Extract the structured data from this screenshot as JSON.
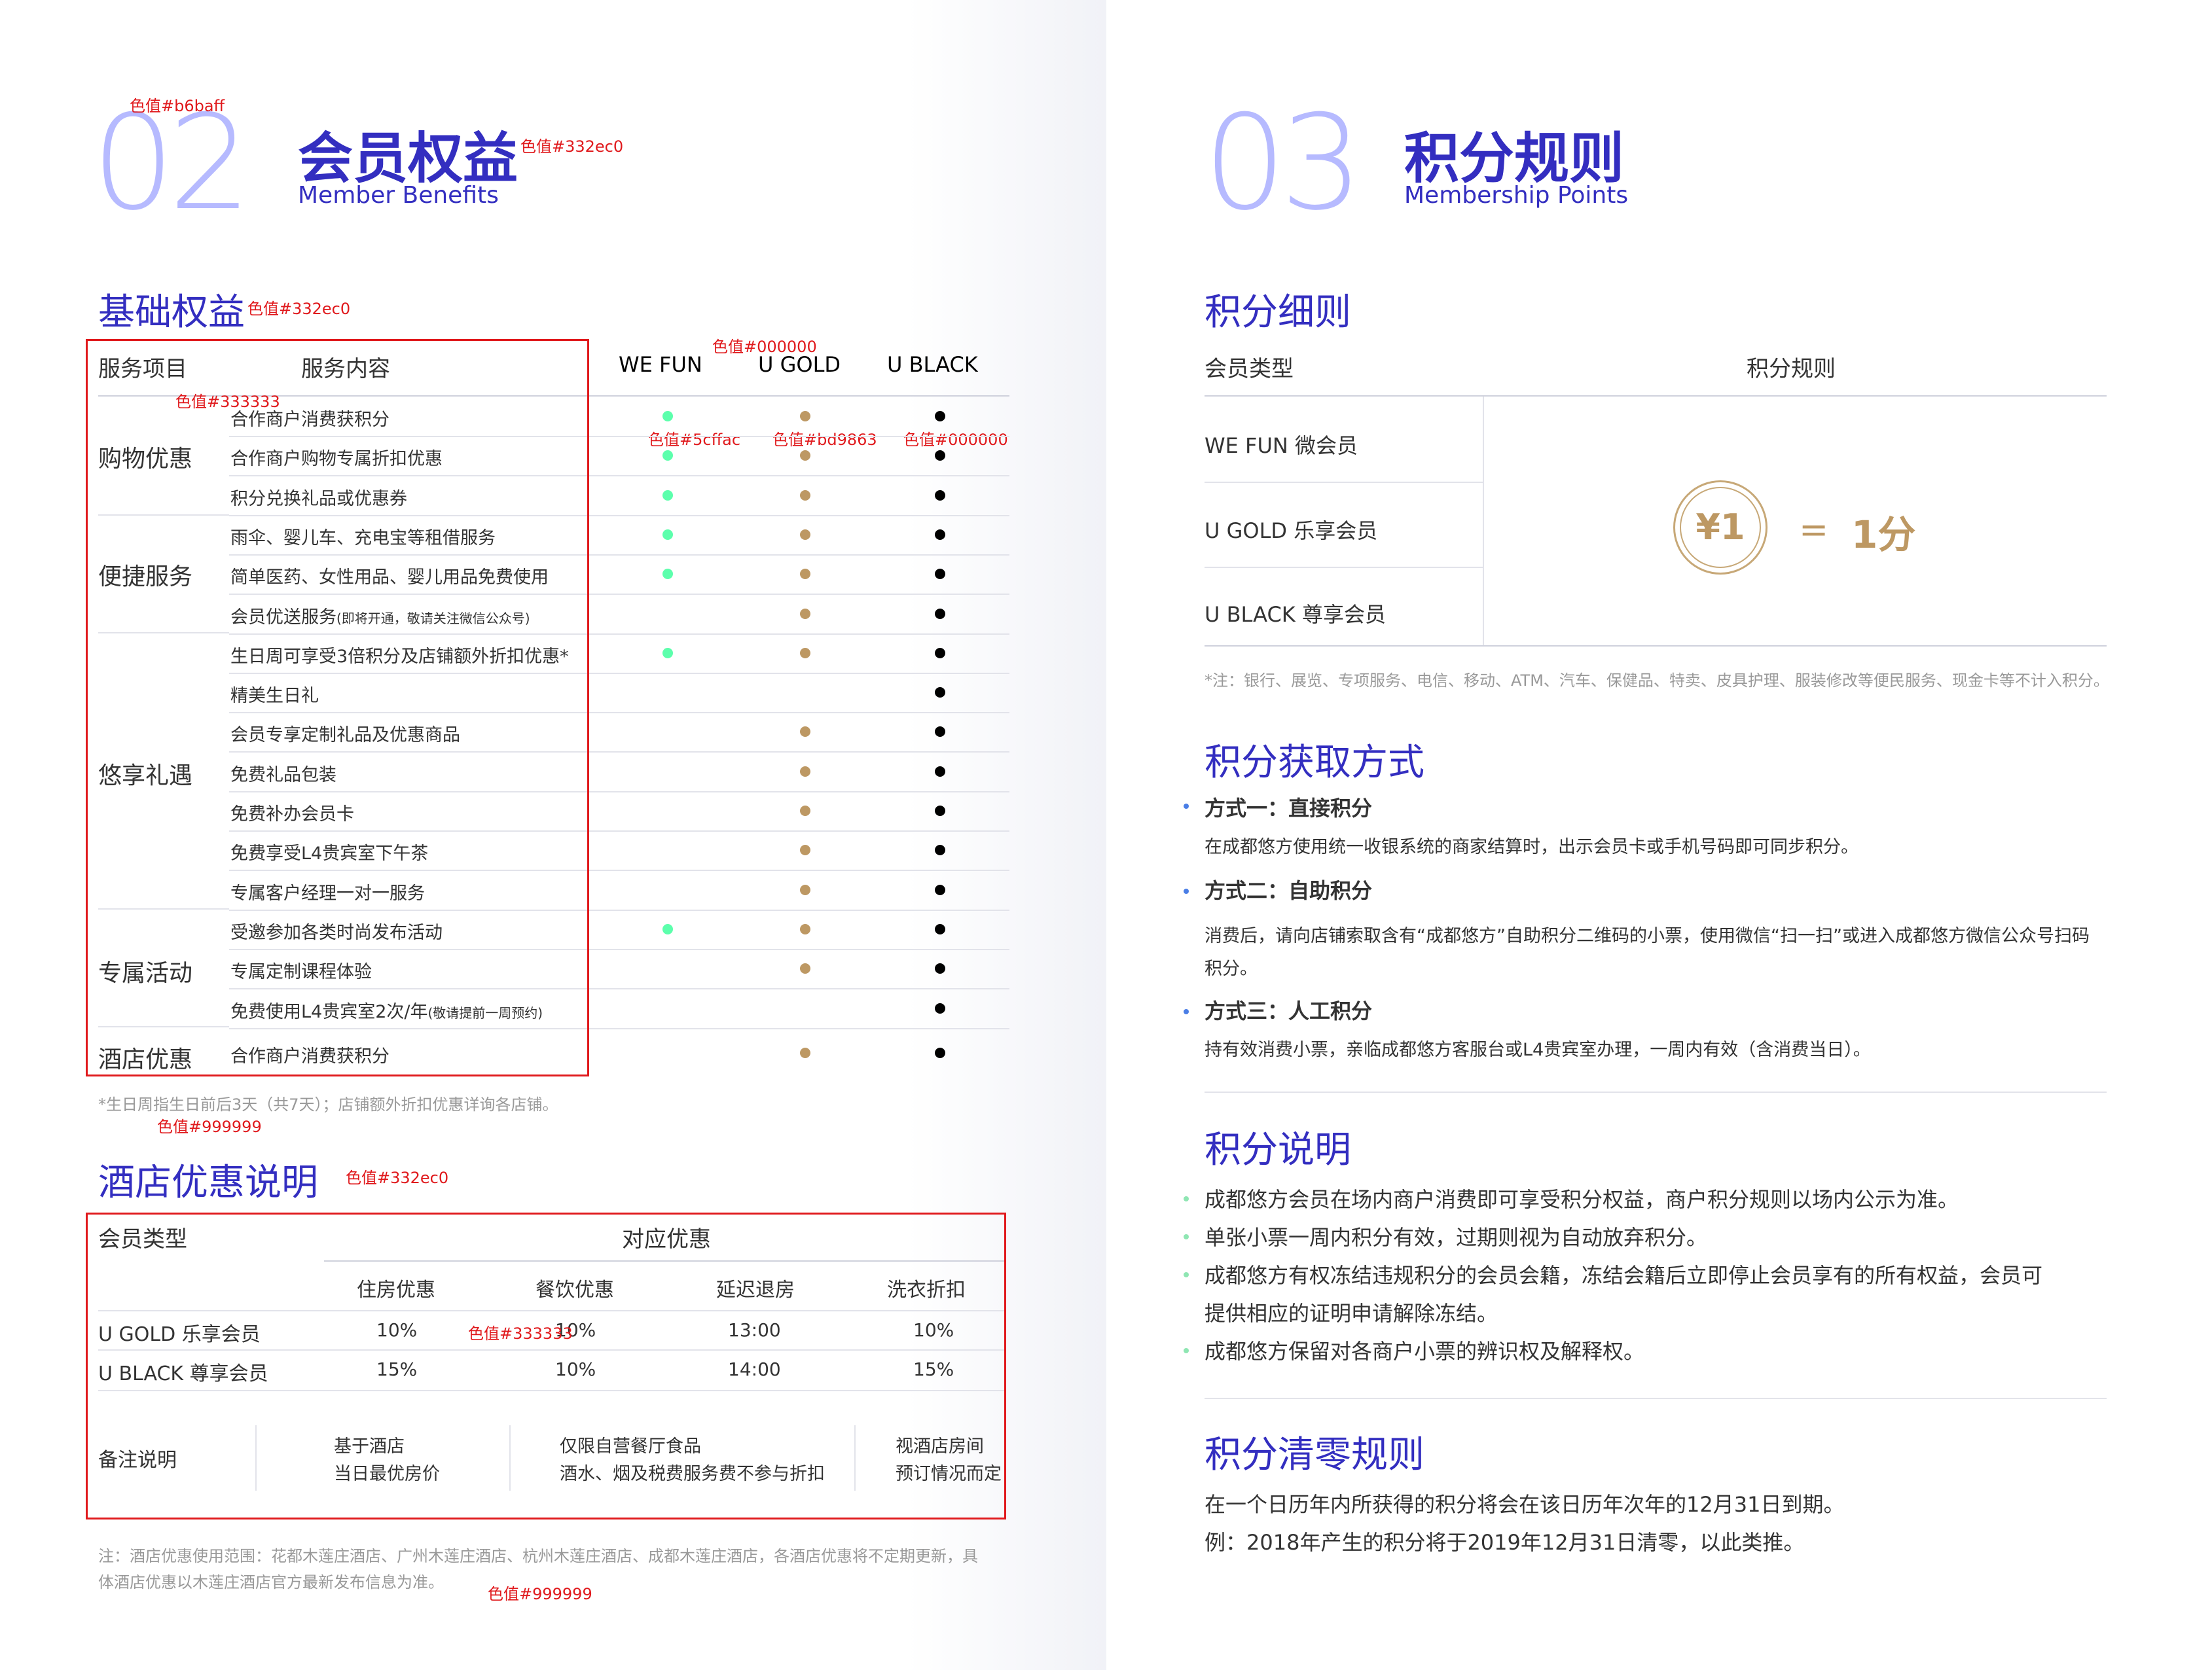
{
  "colors": {
    "primary": "#332ec0",
    "accent_light": "#b6baff",
    "text": "#333333",
    "note": "#999999",
    "annotation": "#e0191c",
    "we_fun": "#5cffac",
    "u_gold": "#bd9863",
    "u_black": "#000000",
    "blue_bullet": "#4a7ee6",
    "green_bullet": "#8fe6b3"
  },
  "left": {
    "number": "02",
    "title": "会员权益",
    "subtitle": "Member Benefits",
    "ann_number_color": "色值#b6baff",
    "ann_title_color": "色值#332ec0",
    "basic": {
      "title": "基础权益",
      "ann_title_color": "色值#332ec0",
      "header": {
        "col1": "服务项目",
        "col2": "服务内容",
        "tier1": "WE FUN",
        "tier2": "U GOLD",
        "tier3": "U BLACK"
      },
      "ann_header_color": "色值#000000",
      "ann_item_color": "色值#333333",
      "ann_we_fun_color": "色值#5cffac",
      "ann_u_gold_color": "色值#bd9863",
      "ann_u_black_color": "色值#000000",
      "categories": [
        "购物优惠",
        "便捷服务",
        "悠享礼遇",
        "专属活动",
        "酒店优惠"
      ],
      "rows": [
        {
          "item": "合作商户消费获积分",
          "small": "",
          "wefun": true,
          "ugold": true,
          "ublack": true
        },
        {
          "item": "合作商户购物专属折扣优惠",
          "small": "",
          "wefun": true,
          "ugold": true,
          "ublack": true
        },
        {
          "item": "积分兑换礼品或优惠券",
          "small": "",
          "wefun": true,
          "ugold": true,
          "ublack": true
        },
        {
          "item": "雨伞、婴儿车、充电宝等租借服务",
          "small": "",
          "wefun": true,
          "ugold": true,
          "ublack": true
        },
        {
          "item": "简单医药、女性用品、婴儿用品免费使用",
          "small": "",
          "wefun": true,
          "ugold": true,
          "ublack": true
        },
        {
          "item": "会员优送服务",
          "small": "(即将开通，敬请关注微信公众号)",
          "wefun": false,
          "ugold": true,
          "ublack": true
        },
        {
          "item": "生日周可享受3倍积分及店铺额外折扣优惠*",
          "small": "",
          "wefun": true,
          "ugold": true,
          "ublack": true
        },
        {
          "item": "精美生日礼",
          "small": "",
          "wefun": false,
          "ugold": false,
          "ublack": true
        },
        {
          "item": "会员专享定制礼品及优惠商品",
          "small": "",
          "wefun": false,
          "ugold": true,
          "ublack": true
        },
        {
          "item": "免费礼品包装",
          "small": "",
          "wefun": false,
          "ugold": true,
          "ublack": true
        },
        {
          "item": "免费补办会员卡",
          "small": "",
          "wefun": false,
          "ugold": true,
          "ublack": true
        },
        {
          "item": "免费享受L4贵宾室下午茶",
          "small": "",
          "wefun": false,
          "ugold": true,
          "ublack": true
        },
        {
          "item": "专属客户经理一对一服务",
          "small": "",
          "wefun": false,
          "ugold": true,
          "ublack": true
        },
        {
          "item": "受邀参加各类时尚发布活动",
          "small": "",
          "wefun": true,
          "ugold": true,
          "ublack": true
        },
        {
          "item": "专属定制课程体验",
          "small": "",
          "wefun": false,
          "ugold": true,
          "ublack": true
        },
        {
          "item": "免费使用L4贵宾室2次/年",
          "small": "(敬请提前一周预约)",
          "wefun": false,
          "ugold": false,
          "ublack": true
        },
        {
          "item": "合作商户消费获积分",
          "small": "",
          "wefun": false,
          "ugold": true,
          "ublack": true
        }
      ],
      "footnote": "*生日周指生日前后3天（共7天）；店铺额外折扣优惠详询各店铺。",
      "ann_footnote_color": "色值#999999"
    },
    "hotel": {
      "title": "酒店优惠说明",
      "ann_title_color": "色值#332ec0",
      "member_type": "会员类型",
      "benefits": "对应优惠",
      "columns": [
        "住房优惠",
        "餐饮优惠",
        "延迟退房",
        "洗衣折扣"
      ],
      "rows": [
        {
          "type": "U GOLD  乐享会员",
          "values": [
            "10%",
            "10%",
            "13:00",
            "10%"
          ]
        },
        {
          "type": "U BLACK  尊享会员",
          "values": [
            "15%",
            "10%",
            "14:00",
            "15%"
          ]
        }
      ],
      "ann_row_color": "色值#333333",
      "remarks_label": "备注说明",
      "remarks": [
        [
          "基于酒店",
          "当日最优房价"
        ],
        [
          "仅限自营餐厅食品",
          "酒水、烟及税费服务费不参与折扣"
        ],
        [
          "视酒店房间",
          "预订情况而定"
        ]
      ],
      "note_line1": "注：酒店优惠使用范围：花都木莲庄酒店、广州木莲庄酒店、杭州木莲庄酒店、成都木莲庄酒店，各酒店优惠将不定期更新，具",
      "note_line2": "体酒店优惠以木莲庄酒店官方最新发布信息为准。",
      "ann_note_color": "色值#999999"
    }
  },
  "right": {
    "number": "03",
    "title": "积分规则",
    "subtitle": "Membership Points",
    "details": {
      "title": "积分细则",
      "col1": "会员类型",
      "col2": "积分规则",
      "types": [
        "WE FUN  微会员",
        "U GOLD  乐享会员",
        "U BLACK  尊享会员"
      ],
      "coin_label": "¥1",
      "equals": "=",
      "points": "1分",
      "note": "*注：银行、展览、专项服务、电信、移动、ATM、汽车、保健品、特卖、皮具护理、服装修改等便民服务、现金卡等不计入积分。"
    },
    "earn": {
      "title": "积分获取方式",
      "methods": [
        {
          "title": "方式一：直接积分",
          "lines": [
            "在成都悠方使用统一收银系统的商家结算时，出示会员卡或手机号码即可同步积分。"
          ]
        },
        {
          "title": "方式二：自助积分",
          "lines": [
            "消费后，请向店铺索取含有“成都悠方”自助积分二维码的小票，使用微信“扫一扫”或进入成都悠方微信公众号扫码",
            "积分。"
          ]
        },
        {
          "title": "方式三：人工积分",
          "lines": [
            "持有效消费小票，亲临成都悠方客服台或L4贵宾室办理，一周内有效（含消费当日）。"
          ]
        }
      ]
    },
    "explain": {
      "title": "积分说明",
      "lines": [
        "成都悠方会员在场内商户消费即可享受积分权益，商户积分规则以场内公示为准。",
        "单张小票一周内积分有效，过期则视为自动放弃积分。",
        "成都悠方有权冻结违规积分的会员会籍，冻结会籍后立即停止会员享有的所有权益，会员可",
        "提供相应的证明申请解除冻结。",
        "成都悠方保留对各商户小票的辨识权及解释权。"
      ]
    },
    "clear": {
      "title": "积分清零规则",
      "lines": [
        "在一个日历年内所获得的积分将会在该日历年次年的12月31日到期。",
        "例：2018年产生的积分将于2019年12月31日清零，以此类推。"
      ]
    }
  }
}
